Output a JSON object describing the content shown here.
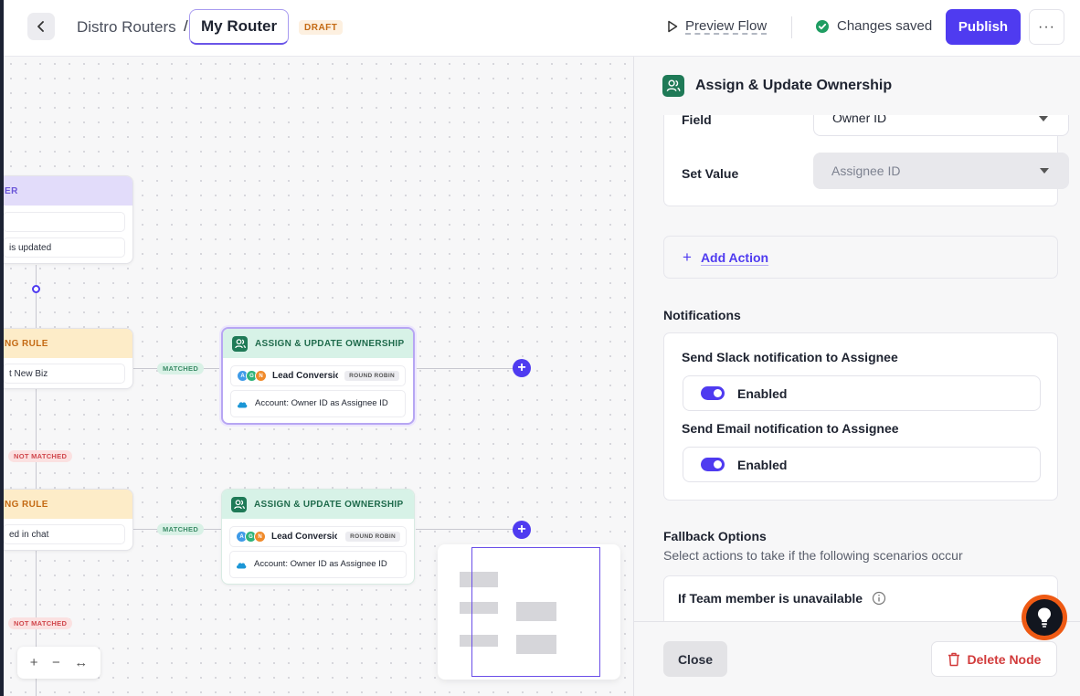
{
  "header": {
    "breadcrumb_parent": "Distro Routers",
    "breadcrumb_separator": "/",
    "breadcrumb_current": "My Router",
    "status_badge": "DRAFT",
    "preview_label": "Preview Flow",
    "saved_label": "Changes saved",
    "publish_label": "Publish",
    "more_label": "···"
  },
  "canvas": {
    "trigger": {
      "title": "ER",
      "row2": "is updated"
    },
    "rule1": {
      "title": "NG RULE",
      "row": "t New Biz"
    },
    "rule2": {
      "title": "NG RULE",
      "row": "ed in chat"
    },
    "matched_label": "MATCHED",
    "not_matched_label": "NOT MATCHED",
    "assign1": {
      "title": "ASSIGN & UPDATE OWNERSHIP",
      "row1": "Lead Conversio",
      "badge": "ROUND ROBIN",
      "row2": "Account: Owner ID as Assignee ID",
      "avatars": [
        "A",
        "G",
        "N"
      ]
    },
    "assign2": {
      "title": "ASSIGN & UPDATE OWNERSHIP",
      "row1": "Lead Conversio",
      "badge": "ROUND ROBIN",
      "row2": "Account: Owner ID as Assignee ID",
      "avatars": [
        "A",
        "G",
        "N"
      ]
    },
    "zoom": {
      "in": "+",
      "out": "−",
      "fit": "↔"
    }
  },
  "panel": {
    "title": "Assign & Update Ownership",
    "field_label": "Field",
    "field_value": "Owner ID",
    "set_value_label": "Set Value",
    "set_value_placeholder": "Assignee ID",
    "add_action_label": "Add Action",
    "notifications_title": "Notifications",
    "slack_label": "Send Slack notification to Assignee",
    "slack_toggle": "Enabled",
    "email_label": "Send Email notification to Assignee",
    "email_toggle": "Enabled",
    "fallback_title": "Fallback Options",
    "fallback_sub": "Select actions to take if the following scenarios occur",
    "fallback_item": "If Team member is unavailable",
    "close_label": "Close",
    "delete_label": "Delete Node"
  },
  "colors": {
    "accent": "#4f3bf0",
    "assign_green": "#1f7a57",
    "danger": "#d23b3b",
    "draft": "#c46a14"
  }
}
